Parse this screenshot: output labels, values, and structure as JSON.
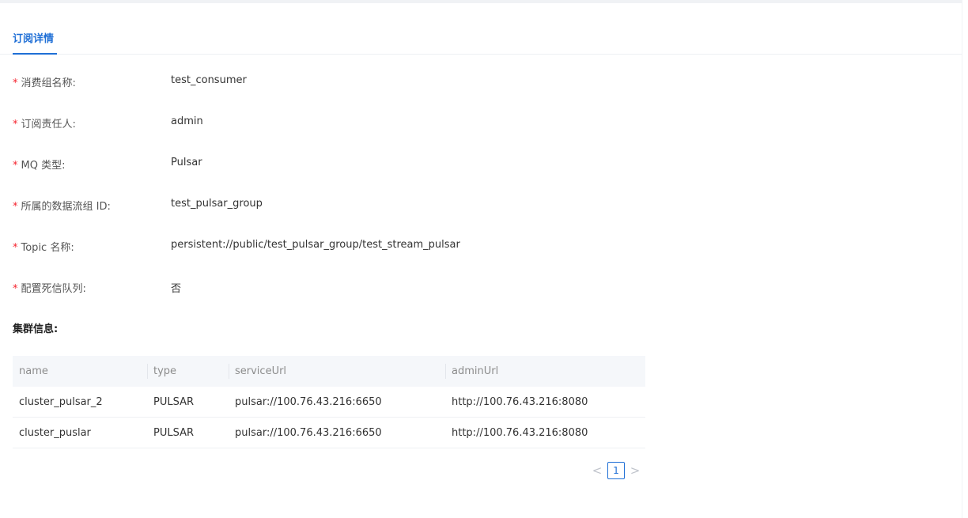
{
  "tabs": [
    {
      "label": "订阅详情"
    }
  ],
  "fields": [
    {
      "label": "消费组名称",
      "value": "test_consumer"
    },
    {
      "label": "订阅责任人",
      "value": "admin"
    },
    {
      "label": "MQ 类型",
      "value": "Pulsar"
    },
    {
      "label": "所属的数据流组 ID",
      "value": "test_pulsar_group"
    },
    {
      "label": "Topic 名称",
      "value": "persistent://public/test_pulsar_group/test_stream_pulsar"
    },
    {
      "label": "配置死信队列",
      "value": "否"
    }
  ],
  "required_mark": "*",
  "label_suffix": ":",
  "cluster": {
    "title": "集群信息:",
    "columns": [
      "name",
      "type",
      "serviceUrl",
      "adminUrl"
    ],
    "rows": [
      [
        "cluster_pulsar_2",
        "PULSAR",
        "pulsar://100.76.43.216:6650",
        "http://100.76.43.216:8080"
      ],
      [
        "cluster_puslar",
        "PULSAR",
        "pulsar://100.76.43.216:6650",
        "http://100.76.43.216:8080"
      ]
    ]
  },
  "pagination": {
    "prev": "<",
    "current": "1",
    "next": ">"
  },
  "colors": {
    "accent": "#1f6fd6",
    "required": "#f5222d",
    "header_bg": "#f5f7fa"
  }
}
